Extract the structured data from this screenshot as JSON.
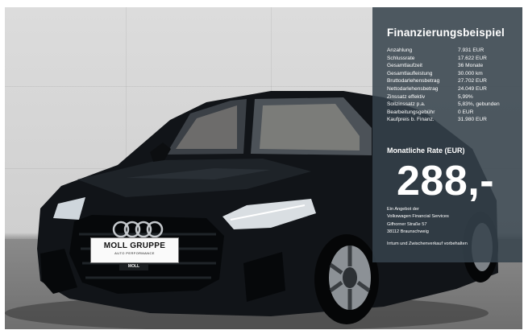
{
  "ad": {
    "title": "Finanzierungsbeispiel",
    "rows": [
      {
        "label": "Anzahlung",
        "value": "7.931 EUR"
      },
      {
        "label": "Schlussrate",
        "value": "17.622 EUR"
      },
      {
        "label": "Gesamtlaufzeit",
        "value": "36 Monate"
      },
      {
        "label": "Gesamtlaufleistung",
        "value": "30.000 km"
      },
      {
        "label": "Bruttodarlehensbetrag",
        "value": "27.702 EUR"
      },
      {
        "label": "Nettodarlehensbetrag",
        "value": "24.049 EUR"
      },
      {
        "label": "Zinssatz effektiv",
        "value": "5,99%"
      },
      {
        "label": "Sollzinssatz p.a.",
        "value": "5,83%, gebunden"
      },
      {
        "label": "Bearbeitungsgebühr",
        "value": "0 EUR"
      },
      {
        "label": "Kaufpreis b. Finanz.",
        "value": "31.980 EUR"
      }
    ],
    "rate_label": "Monatliche Rate (EUR)",
    "rate_value": "288,-",
    "offer_lines": [
      "Ein Angebot der",
      "Volkswagen Financial Services",
      "Gifhorner Straße 57",
      "38112 Braunschweig"
    ],
    "disclaimer": "Irrtum und Zwischenverkauf vorbehalten"
  },
  "plate": {
    "line1": "MOLL GRUPPE",
    "line2": "AUTO PERFORMANCE",
    "line3": "MOLL"
  },
  "colors": {
    "panel": "#36424C",
    "car_body": "#111418",
    "wall": "#D6D6D6",
    "floor": "#7A7A7A"
  }
}
